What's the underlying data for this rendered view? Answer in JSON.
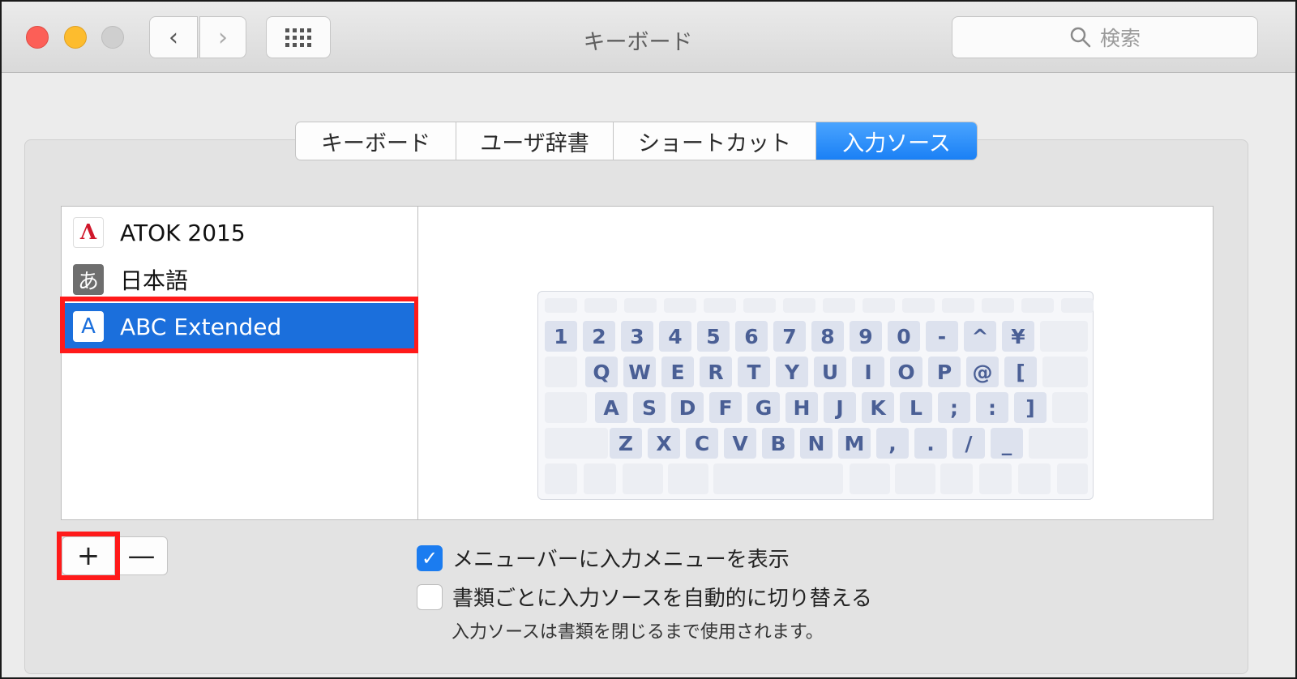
{
  "window": {
    "title": "キーボード",
    "search_placeholder": "検索",
    "back_glyph": "‹",
    "forward_glyph": "›"
  },
  "tabs": [
    {
      "label": "キーボード",
      "active": false
    },
    {
      "label": "ユーザ辞書",
      "active": false
    },
    {
      "label": "ショートカット",
      "active": false
    },
    {
      "label": "入力ソース",
      "active": true
    }
  ],
  "input_sources": [
    {
      "label": "ATOK 2015",
      "icon": "atok-icon",
      "icon_glyph": "Λ",
      "selected": false
    },
    {
      "label": "日本語",
      "icon": "hiragana-icon",
      "icon_glyph": "あ",
      "selected": false
    },
    {
      "label": "ABC Extended",
      "icon": "abc-icon",
      "icon_glyph": "A",
      "selected": true
    }
  ],
  "keyboard_rows": [
    [
      "1",
      "2",
      "3",
      "4",
      "5",
      "6",
      "7",
      "8",
      "9",
      "0",
      "-",
      "^",
      "¥"
    ],
    [
      "Q",
      "W",
      "E",
      "R",
      "T",
      "Y",
      "U",
      "I",
      "O",
      "P",
      "@",
      "["
    ],
    [
      "A",
      "S",
      "D",
      "F",
      "G",
      "H",
      "J",
      "K",
      "L",
      ";",
      ":",
      "]"
    ],
    [
      "Z",
      "X",
      "C",
      "V",
      "B",
      "N",
      "M",
      ",",
      ".",
      "/",
      "_"
    ]
  ],
  "buttons": {
    "add": "+",
    "remove": "—"
  },
  "options": {
    "show_input_menu": {
      "label": "メニューバーに入力メニューを表示",
      "checked": true
    },
    "auto_switch": {
      "label": "書類ごとに入力ソースを自動的に切り替える",
      "checked": false
    },
    "auto_switch_note": "入力ソースは書類を閉じるまで使用されます。"
  },
  "colors": {
    "accent": "#1b6fdc",
    "highlight_box": "#ff1a1a"
  }
}
